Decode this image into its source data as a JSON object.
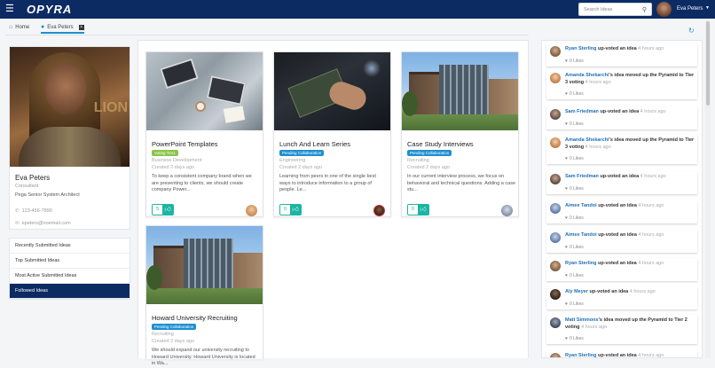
{
  "header": {
    "logo_text": "OPYRA",
    "search_placeholder": "Search Ideas",
    "user_name": "Eva Peters"
  },
  "tabs": [
    {
      "label": "Home"
    },
    {
      "label": "Eva Peters"
    }
  ],
  "profile": {
    "name": "Eva Peters",
    "role": "Consultant",
    "title": "Pega Senior System Architect",
    "phone": "123-456-7890",
    "email": "epeters@noemail.com"
  },
  "menu": [
    {
      "label": "Recently Submitted Ideas",
      "active": false
    },
    {
      "label": "Top Submitted Ideas",
      "active": false
    },
    {
      "label": "Most Active Submitted Ideas",
      "active": false
    },
    {
      "label": "Followed Ideas",
      "active": true
    }
  ],
  "ideas": [
    {
      "title": "PowerPoint Templates",
      "status": "Voting Tier1",
      "category": "Business Development",
      "age": "Created 2 days ago",
      "description": "To keep a consistent company brand when we are presenting to clients, we should create company Power...",
      "likes": "5"
    },
    {
      "title": "Lunch And Learn Series",
      "status": "Pending Collaboration",
      "category": "Engineering",
      "age": "Created 2 days ago",
      "description": "Learning from peers in one of the single best ways to introduce information to a group of people. Le...",
      "likes": "0"
    },
    {
      "title": "Case Study Interviews",
      "status": "Pending Collaboration",
      "category": "Recruiting",
      "age": "Created 2 days ago",
      "description": "In our current interview process, we focus on behavioral and technical questions. Adding a case stu...",
      "likes": "0"
    },
    {
      "title": "Howard University Recruiting",
      "status": "Pending Collaboration",
      "category": "Recruiting",
      "age": "Created 2 days ago",
      "description": "We should expand our university recruiting to Howard University. Howard University is located in Wa..."
    }
  ],
  "feed": [
    {
      "who": "Ryan Sterling",
      "action": "up-voted an idea",
      "when": "4 hours ago",
      "likes": "0 Likes"
    },
    {
      "who": "Amanda Shekarchi",
      "action": "'s idea moved up the Pyramid to Tier 3 voting",
      "when": "4 hours ago",
      "likes": "0 Likes"
    },
    {
      "who": "Sam Friedman",
      "action": "up-voted an idea",
      "when": "4 hours ago",
      "likes": "0 Likes"
    },
    {
      "who": "Amanda Shekarchi",
      "action": "'s idea moved up the Pyramid to Tier 3 voting",
      "when": "4 hours ago",
      "likes": "0 Likes"
    },
    {
      "who": "Sam Friedman",
      "action": "up-voted an idea",
      "when": "4 hours ago",
      "likes": "0 Likes"
    },
    {
      "who": "Aimee Tandoi",
      "action": "up-voted an idea",
      "when": "4 hours ago",
      "likes": "0 Likes"
    },
    {
      "who": "Aimee Tandoi",
      "action": "up-voted an idea",
      "when": "4 hours ago",
      "likes": "0 Likes"
    },
    {
      "who": "Ryan Sterling",
      "action": "up-voted an idea",
      "when": "4 hours ago",
      "likes": "0 Likes"
    },
    {
      "who": "Aly Meyer",
      "action": "up-voted an idea",
      "when": "4 hours ago",
      "likes": "0 Likes"
    },
    {
      "who": "Matt Simmons",
      "action": "'s idea moved up the Pyramid to Tier 2 voting",
      "when": "4 hours ago",
      "likes": "0 Likes"
    },
    {
      "who": "Ryan Sterling",
      "action": "up-voted an idea",
      "when": "4 hours ago"
    }
  ],
  "colors": {
    "navbar": "#0c2b63",
    "accent": "#1e8fcf",
    "like": "#1bb5a3",
    "badge_green": "#8bc34a"
  },
  "icons": {
    "menu": "hamburger-icon",
    "search": "search-icon",
    "home": "home-icon",
    "user": "user-icon",
    "refresh": "refresh-icon",
    "phone": "phone-icon",
    "email": "email-icon",
    "like": "thumbs-up-icon",
    "heart": "heart-icon"
  }
}
